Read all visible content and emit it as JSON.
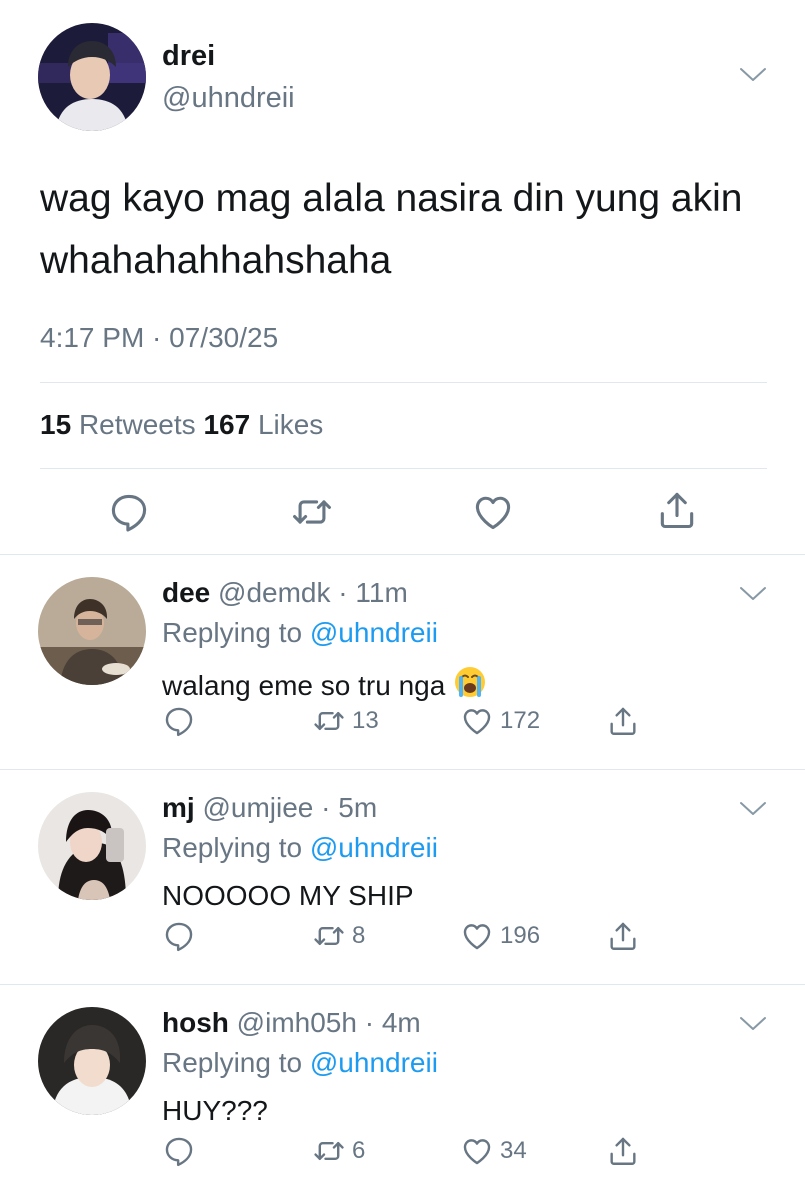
{
  "main_tweet": {
    "name": "drei",
    "handle": "@uhndreii",
    "text": "wag kayo mag alala nasira din yung akin whahahahhahshaha",
    "time": "4:17 PM · 07/30/25",
    "retweets": "15",
    "retweets_label": "Retweets",
    "likes": "167",
    "likes_label": "Likes"
  },
  "replies": [
    {
      "name": "dee",
      "handle_time": "@demdk · 11m",
      "replying_prefix": "Replying to",
      "replying_handle": "@uhndreii",
      "text": "walang eme so tru nga",
      "emoji": "😭",
      "retweets": "13",
      "likes": "172"
    },
    {
      "name": "mj",
      "handle_time": "@umjiee · 5m",
      "replying_prefix": "Replying to",
      "replying_handle": "@uhndreii",
      "text": "NOOOOO MY SHIP",
      "retweets": "8",
      "likes": "196"
    },
    {
      "name": "hosh",
      "handle_time": "@imh05h · 4m",
      "replying_prefix": "Replying to",
      "replying_handle": "@uhndreii",
      "text": "HUY???",
      "retweets": "6",
      "likes": "34"
    }
  ],
  "colors": {
    "text": "#14171a",
    "secondary": "#687684",
    "link": "#1d9bf0",
    "divider": "#e1e8ed"
  },
  "icons": [
    "reply-icon",
    "retweet-icon",
    "like-icon",
    "share-icon",
    "chevron-down-icon"
  ]
}
